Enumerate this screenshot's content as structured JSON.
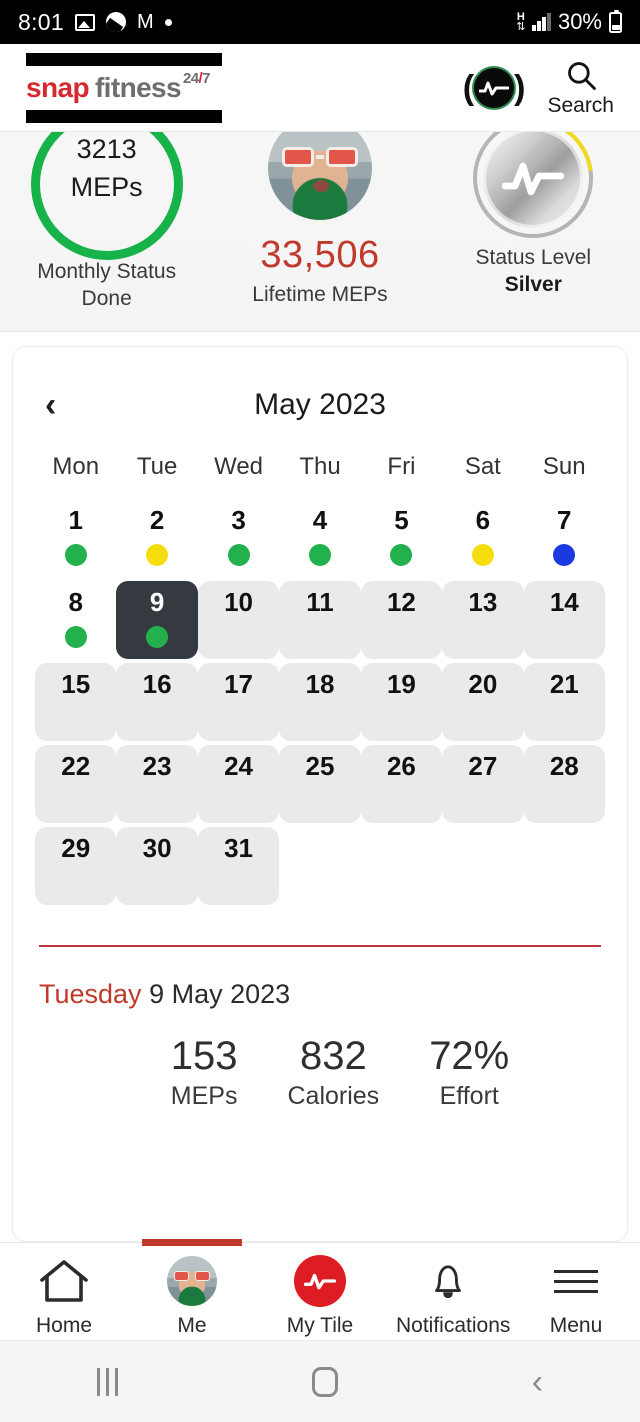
{
  "status_bar": {
    "time": "8:01",
    "icons_left": [
      "photos-icon",
      "app-icon",
      "gmail-icon",
      "dot-icon"
    ],
    "network_type": "H",
    "battery_percent": "30%",
    "icons_right": [
      "data-transfer-icon",
      "signal-icon",
      "battery-icon"
    ]
  },
  "header": {
    "logo_snap": "snap",
    "logo_fitness": "fitness",
    "logo_247_num": "24",
    "logo_247_slash": "/",
    "logo_247_den": "7",
    "search_label": "Search"
  },
  "stats": {
    "monthly": {
      "value": "3213",
      "unit": "MEPs",
      "caption_line1": "Monthly Status",
      "caption_line2": "Done",
      "ring_color": "#15b34a"
    },
    "lifetime": {
      "value": "33,506",
      "caption": "Lifetime MEPs",
      "value_color": "#c0392b"
    },
    "status_level": {
      "caption": "Status Level",
      "value": "Silver"
    }
  },
  "calendar": {
    "title": "May 2023",
    "prev_label": "‹",
    "weekdays": [
      "Mon",
      "Tue",
      "Wed",
      "Thu",
      "Fri",
      "Sat",
      "Sun"
    ],
    "days": [
      {
        "num": "1",
        "style": "plain",
        "dot": "green"
      },
      {
        "num": "2",
        "style": "plain",
        "dot": "yellow"
      },
      {
        "num": "3",
        "style": "plain",
        "dot": "green"
      },
      {
        "num": "4",
        "style": "plain",
        "dot": "green"
      },
      {
        "num": "5",
        "style": "plain",
        "dot": "green"
      },
      {
        "num": "6",
        "style": "plain",
        "dot": "yellow"
      },
      {
        "num": "7",
        "style": "plain",
        "dot": "blue"
      },
      {
        "num": "8",
        "style": "plain",
        "dot": "green"
      },
      {
        "num": "9",
        "style": "selected",
        "dot": "green"
      },
      {
        "num": "10",
        "style": "filled",
        "dot": null
      },
      {
        "num": "11",
        "style": "filled",
        "dot": null
      },
      {
        "num": "12",
        "style": "filled",
        "dot": null
      },
      {
        "num": "13",
        "style": "filled",
        "dot": null
      },
      {
        "num": "14",
        "style": "filled",
        "dot": null
      },
      {
        "num": "15",
        "style": "filled",
        "dot": null
      },
      {
        "num": "16",
        "style": "filled",
        "dot": null
      },
      {
        "num": "17",
        "style": "filled",
        "dot": null
      },
      {
        "num": "18",
        "style": "filled",
        "dot": null
      },
      {
        "num": "19",
        "style": "filled",
        "dot": null
      },
      {
        "num": "20",
        "style": "filled",
        "dot": null
      },
      {
        "num": "21",
        "style": "filled",
        "dot": null
      },
      {
        "num": "22",
        "style": "filled",
        "dot": null
      },
      {
        "num": "23",
        "style": "filled",
        "dot": null
      },
      {
        "num": "24",
        "style": "filled",
        "dot": null
      },
      {
        "num": "25",
        "style": "filled",
        "dot": null
      },
      {
        "num": "26",
        "style": "filled",
        "dot": null
      },
      {
        "num": "27",
        "style": "filled",
        "dot": null
      },
      {
        "num": "28",
        "style": "filled",
        "dot": null
      },
      {
        "num": "29",
        "style": "filled",
        "dot": null
      },
      {
        "num": "30",
        "style": "filled",
        "dot": null
      },
      {
        "num": "31",
        "style": "filled",
        "dot": null
      }
    ],
    "dot_colors": {
      "green": "#22b14c",
      "yellow": "#f5dd0e",
      "blue": "#1b39e0"
    },
    "selected_bg": "#343a40",
    "cell_bg": "#eaeaea"
  },
  "detail": {
    "divider_color": "#b9383a",
    "day_of_week": "Tuesday",
    "date": " 9 May 2023",
    "stats": [
      {
        "value": "153",
        "label": "MEPs"
      },
      {
        "value": "832",
        "label": "Calories"
      },
      {
        "value": "72%",
        "label": "Effort"
      }
    ]
  },
  "bottom_nav": {
    "active_color": "#c0392b",
    "items": [
      {
        "label": "Home",
        "icon": "home-icon",
        "active": false
      },
      {
        "label": "Me",
        "icon": "avatar-icon",
        "active": true
      },
      {
        "label": "My Tile",
        "icon": "my-tile-icon",
        "active": false
      },
      {
        "label": "Notifications",
        "icon": "bell-icon",
        "active": false
      },
      {
        "label": "Menu",
        "icon": "hamburger-icon",
        "active": false
      }
    ]
  },
  "system_nav": {
    "recents": "recents-icon",
    "home": "home-button-icon",
    "back": "back-icon"
  }
}
